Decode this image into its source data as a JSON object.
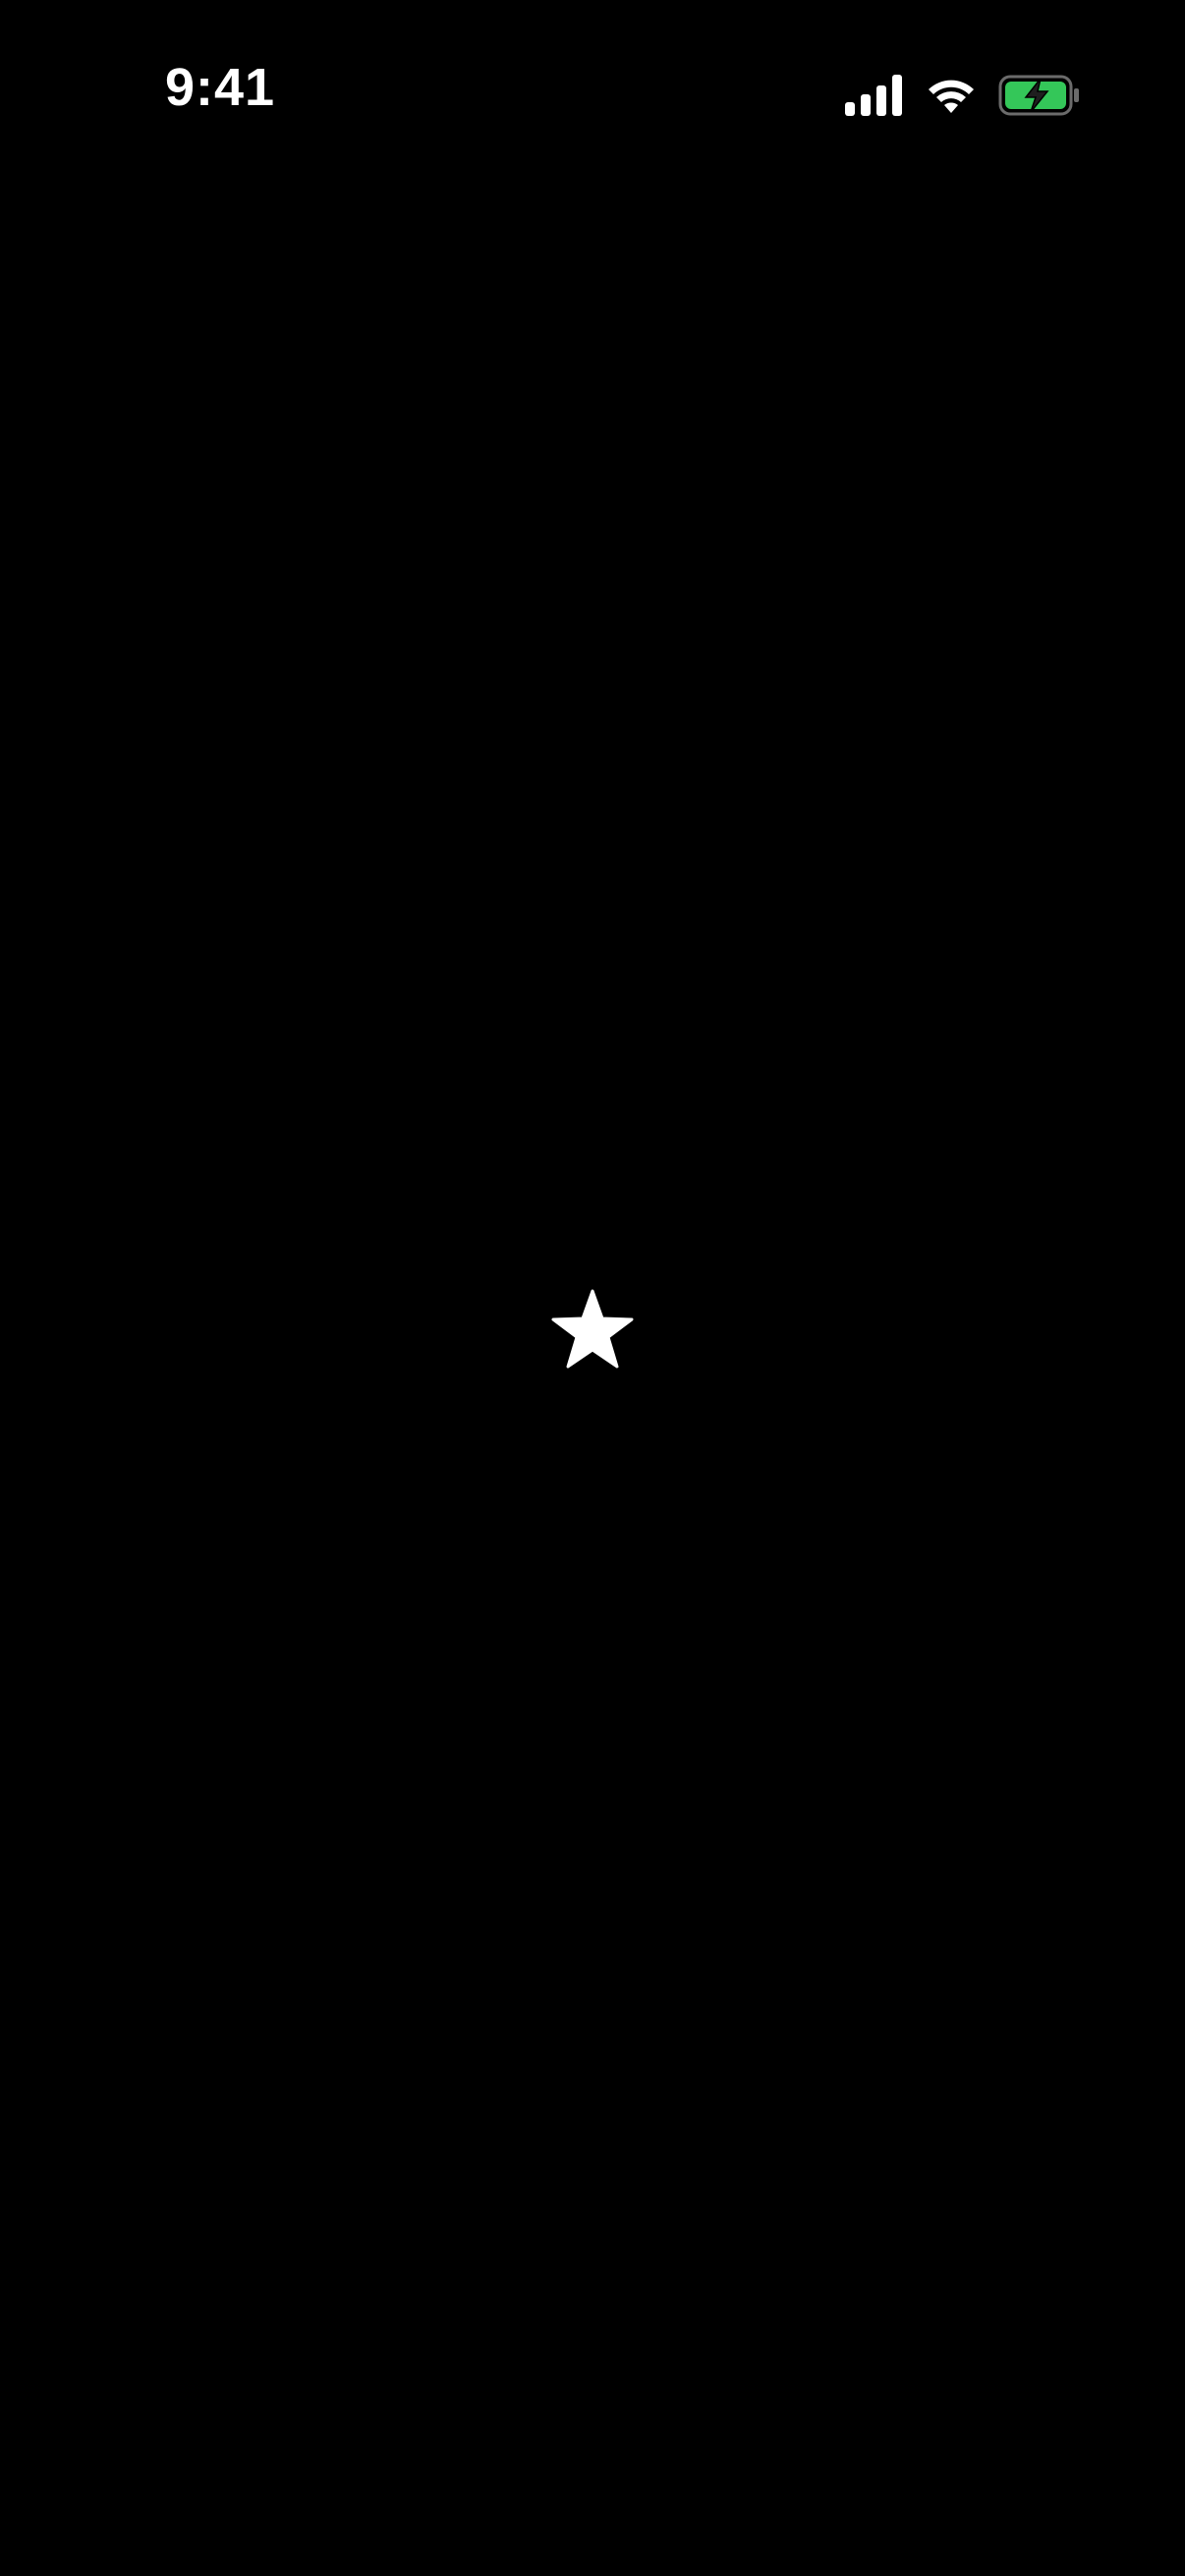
{
  "status_bar": {
    "time": "9:41",
    "icons": [
      "cellular-signal-icon",
      "wifi-icon",
      "battery-charging-icon"
    ]
  },
  "main": {
    "icon": "star-icon"
  },
  "colors": {
    "background": "#000000",
    "foreground": "#ffffff",
    "battery_fill": "#34c759"
  }
}
